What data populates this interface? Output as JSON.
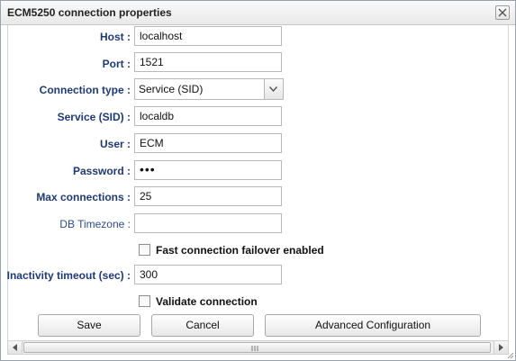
{
  "window": {
    "title": "ECM5250 connection properties"
  },
  "fields": [
    {
      "key": "host",
      "label": "Host :",
      "value": "localhost",
      "bold": true
    },
    {
      "key": "port",
      "label": "Port :",
      "value": "1521",
      "bold": true
    },
    {
      "key": "connection_type",
      "label": "Connection type :",
      "value": "Service (SID)",
      "bold": true
    },
    {
      "key": "service_sid",
      "label": "Service (SID) :",
      "value": "localdb",
      "bold": true
    },
    {
      "key": "user",
      "label": "User :",
      "value": "ECM",
      "bold": true
    },
    {
      "key": "password",
      "label": "Password :",
      "value": "•••",
      "bold": true
    },
    {
      "key": "max_connections",
      "label": "Max connections :",
      "value": "25",
      "bold": true
    },
    {
      "key": "db_timezone",
      "label": "DB Timezone :",
      "value": "",
      "bold": false
    },
    {
      "key": "inactivity_timeout",
      "label": "Inactivity timeout (sec) :",
      "value": "300",
      "bold": true
    }
  ],
  "checkboxes": {
    "fast_failover": {
      "label": "Fast connection failover enabled",
      "checked": false
    },
    "validate": {
      "label": "Validate connection",
      "checked": false
    }
  },
  "buttons": {
    "save": "Save",
    "cancel": "Cancel",
    "advanced": "Advanced Configuration"
  },
  "colors": {
    "label": "#1f3a73",
    "border": "#b8b8b8"
  }
}
